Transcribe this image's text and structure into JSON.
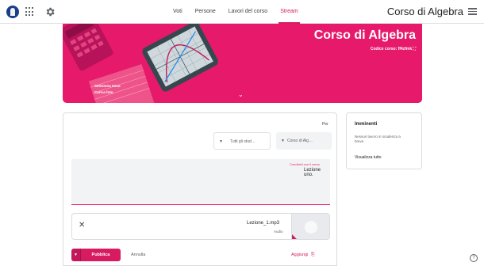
{
  "header": {
    "app_title": "Corso di Algebra",
    "tabs": [
      {
        "label": "Stream",
        "active": true
      },
      {
        "label": "Lavori del corso",
        "active": false
      },
      {
        "label": "Persone",
        "active": false
      },
      {
        "label": "Voti",
        "active": false
      }
    ],
    "icons": [
      "menu-icon",
      "apps-icon",
      "gear-icon",
      "avatar"
    ]
  },
  "banner": {
    "class_title": "Corso di Algebra",
    "class_code": "Codice corso: ff4zfmk ⛶",
    "select_theme": "Seleziona tema",
    "upload_photo": "Carica foto",
    "expand_icon": "chevron-down-icon",
    "color": "#e7196b"
  },
  "upcoming": {
    "title": "Imminenti",
    "text": "Nessun lavoro in scadenza a breve",
    "link": "Visualizza tutto"
  },
  "composer": {
    "for_label": "Per",
    "course_select": "Corso di Alg…",
    "students_select": "Tutti gli stud…",
    "textarea_label": "Condividi con il corso",
    "textarea_value": "Lezione uno.",
    "attachment": {
      "name": "Lezione_1.mp3",
      "type": "Audio"
    },
    "add_button": "Aggiungi",
    "cancel_button": "Annulla",
    "publish_button": "Pubblica",
    "accent": "#d81b60"
  },
  "help_icon": "?"
}
